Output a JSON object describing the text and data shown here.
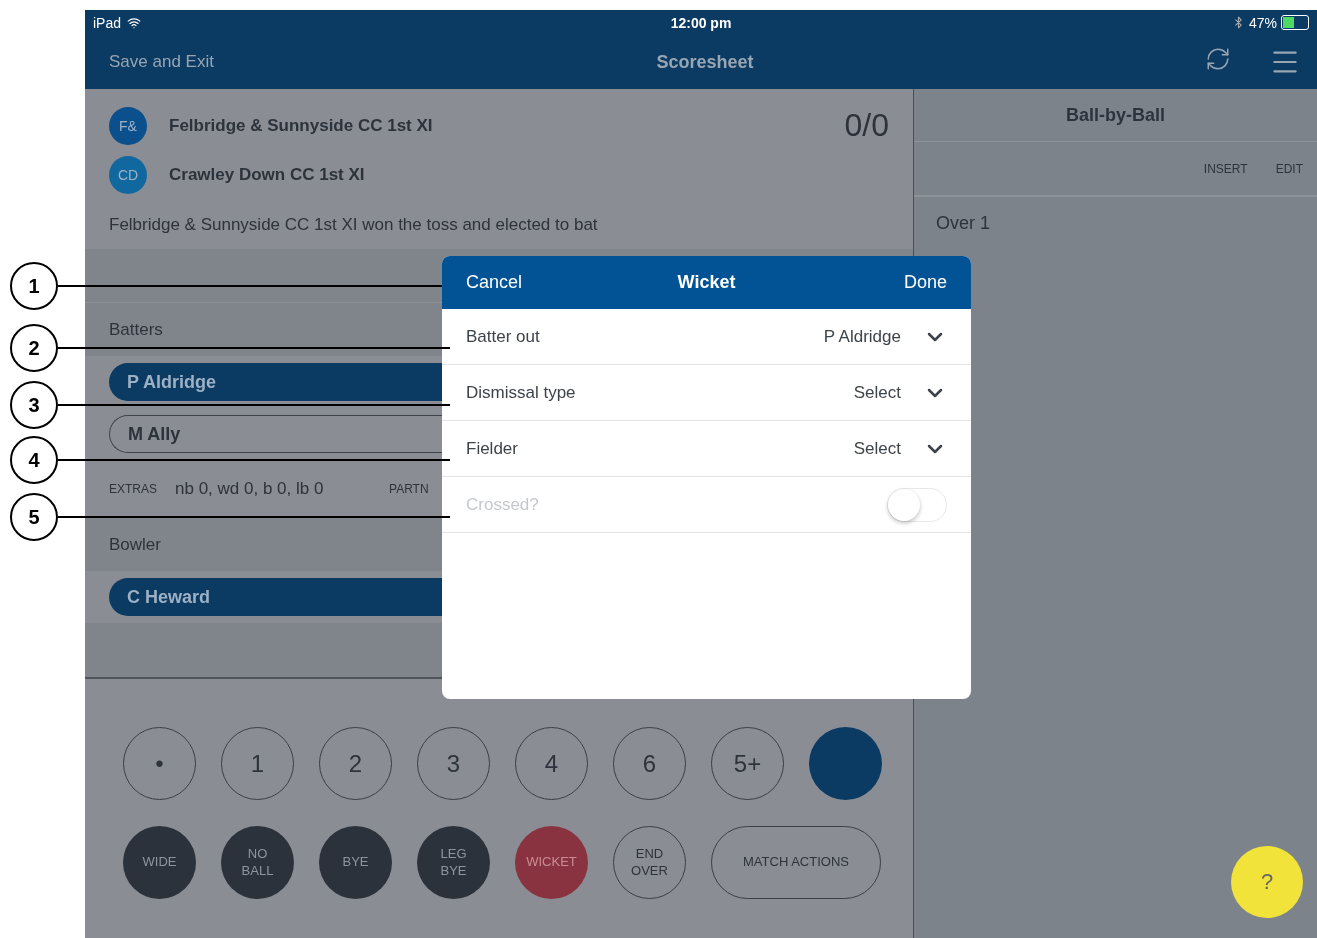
{
  "status_bar": {
    "device": "iPad",
    "time": "12:00 pm",
    "battery": "47%"
  },
  "nav": {
    "left": "Save and Exit",
    "title": "Scoresheet"
  },
  "teams": [
    {
      "badge": "F&",
      "name": "Felbridge & Sunnyside CC 1st XI",
      "color": "#0b4f8c"
    },
    {
      "badge": "CD",
      "name": "Crawley Down CC 1st XI",
      "color": "#11689e"
    }
  ],
  "score": "0/0",
  "toss": "Felbridge & Sunnyside CC 1st XI won the toss and elected to bat",
  "batters_label": "Batters",
  "batters": [
    {
      "name": "P Aldridge",
      "selected": true
    },
    {
      "name": "M Ally",
      "selected": false
    }
  ],
  "extras": {
    "label": "EXTRAS",
    "value": "nb 0, wd 0, b 0, lb 0",
    "partnership_label": "PARTN"
  },
  "bowler_label": "Bowler",
  "bowlers": [
    {
      "name": "C Heward",
      "selected": true
    }
  ],
  "run_buttons": [
    {
      "kind": "outline",
      "label": "•"
    },
    {
      "kind": "outline",
      "label": "1"
    },
    {
      "kind": "outline",
      "label": "2"
    },
    {
      "kind": "outline",
      "label": "3"
    },
    {
      "kind": "outline",
      "label": "4"
    },
    {
      "kind": "outline",
      "label": "6"
    },
    {
      "kind": "outline",
      "label": "5+"
    },
    {
      "kind": "blank"
    }
  ],
  "action_buttons": [
    {
      "kind": "dark",
      "label": "WIDE"
    },
    {
      "kind": "dark",
      "label": "NO BALL"
    },
    {
      "kind": "dark",
      "label": "BYE"
    },
    {
      "kind": "dark",
      "label": "LEG BYE"
    },
    {
      "kind": "danger",
      "label": "WICKET"
    },
    {
      "kind": "outline",
      "label": "END OVER"
    },
    {
      "kind": "wide",
      "label": "MATCH ACTIONS"
    }
  ],
  "ball_by_ball": {
    "title": "Ball-by-Ball",
    "actions": [
      "INSERT",
      "EDIT"
    ],
    "over": "Over 1"
  },
  "help": "?",
  "modal": {
    "cancel": "Cancel",
    "title": "Wicket",
    "done": "Done",
    "rows": [
      {
        "kind": "select",
        "label": "Batter out",
        "value": "P Aldridge"
      },
      {
        "kind": "select",
        "label": "Dismissal type",
        "value": "Select"
      },
      {
        "kind": "select",
        "label": "Fielder",
        "value": "Select"
      },
      {
        "kind": "toggle",
        "label": "Crossed?",
        "on": false,
        "disabled": true
      }
    ]
  },
  "callouts": [
    "1",
    "2",
    "3",
    "4",
    "5"
  ]
}
